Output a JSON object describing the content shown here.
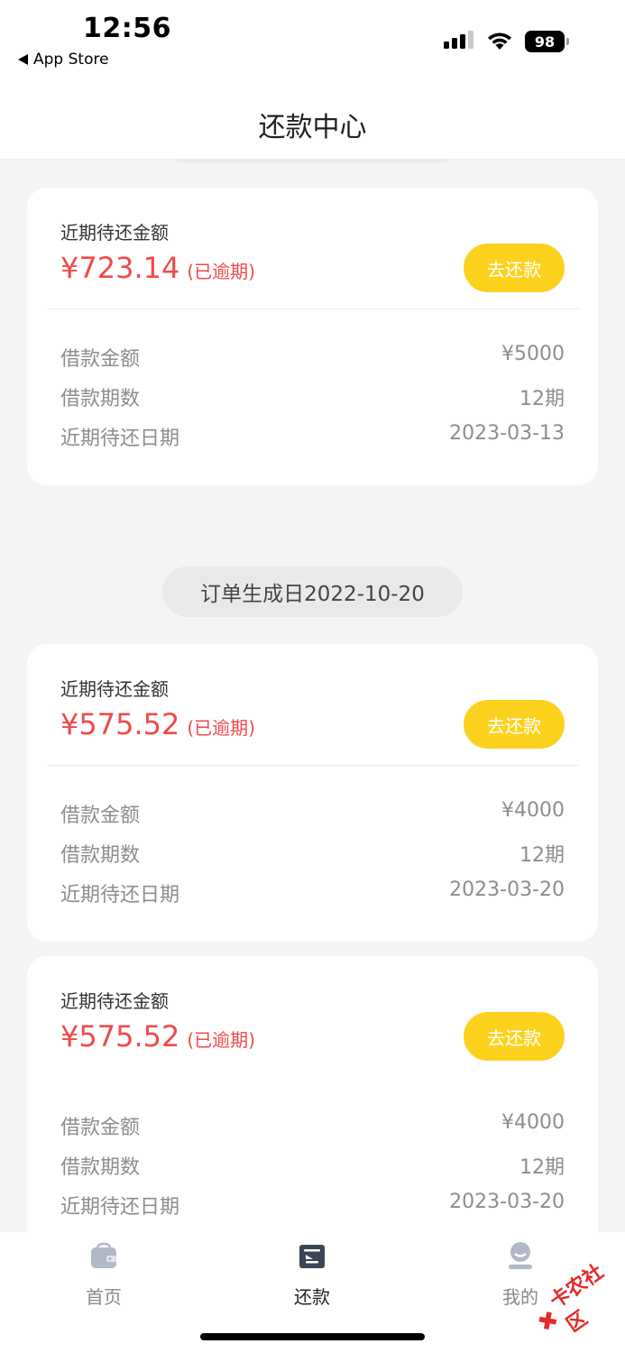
{
  "status_bar": {
    "time": "12:56",
    "back_app": "App Store",
    "battery": "98"
  },
  "header": {
    "title": "还款中心"
  },
  "labels": {
    "recent_due": "近期待还金额",
    "overdue": "(已逾期)",
    "repay_button": "去还款",
    "loan_amount": "借款金额",
    "loan_periods": "借款期数",
    "due_date": "近期待还日期"
  },
  "order_date_pill": "订单生成日2022-10-20",
  "cards": [
    {
      "amount": "¥723.14",
      "loan_amount": "¥5000",
      "periods": "12期",
      "due_date": "2023-03-13"
    },
    {
      "amount": "¥575.52",
      "loan_amount": "¥4000",
      "periods": "12期",
      "due_date": "2023-03-20"
    },
    {
      "amount": "¥575.52",
      "loan_amount": "¥4000",
      "periods": "12期",
      "due_date": "2023-03-20"
    }
  ],
  "tabs": [
    {
      "label": "首页",
      "icon": "wallet-icon",
      "active": false
    },
    {
      "label": "还款",
      "icon": "bill-icon",
      "active": true
    },
    {
      "label": "我的",
      "icon": "profile-icon",
      "active": false
    }
  ],
  "watermark": "卡农社区",
  "colors": {
    "accent_yellow": "#fdd21f",
    "overdue_red": "#f04a4a",
    "background": "#f4f4f4"
  }
}
